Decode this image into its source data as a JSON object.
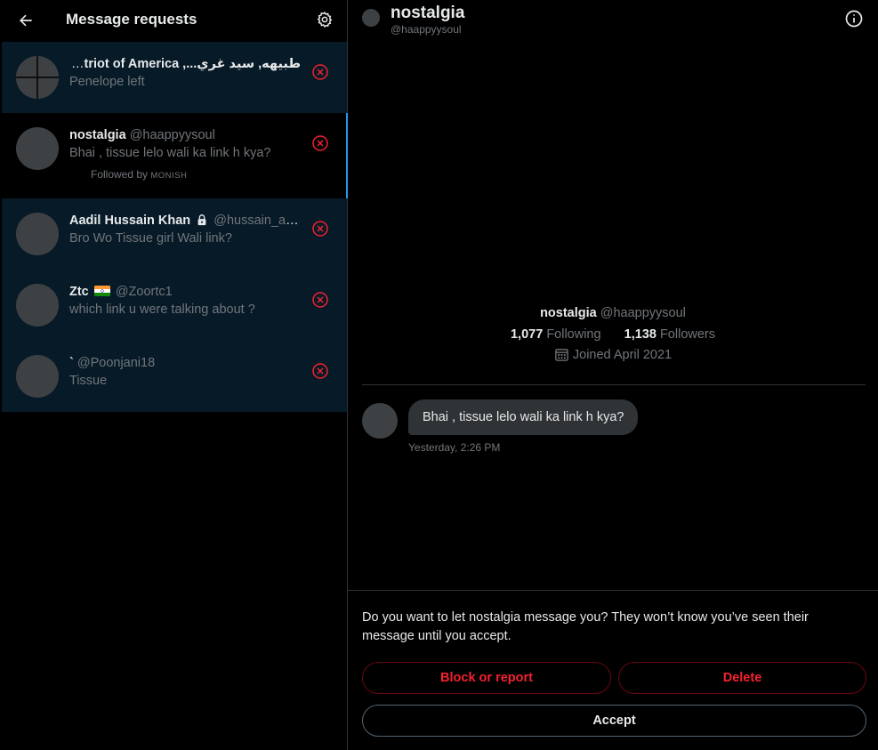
{
  "left": {
    "title": "Message requests",
    "requests": [
      {
        "name": "طبيهه, سيد غري..., Patriot of America",
        "handle": "",
        "preview": "Penelope left",
        "sub": ""
      },
      {
        "name": "nostalgia",
        "handle": "@haappyysoul",
        "preview": "Bhai , tissue lelo wali ka link h kya?",
        "sub_prefix": "Followed by",
        "sub_name": "MONISH"
      },
      {
        "name": "Aadil Hussain Khan",
        "handle": "@hussain_aa...",
        "preview": "Bro Wo Tissue girl Wali link?"
      },
      {
        "name": "Ztc",
        "handle": "@Zoortc1",
        "preview": "which link u were talking about ?"
      },
      {
        "name": "`",
        "handle": "@Poonjani18",
        "preview": "Tissue"
      }
    ]
  },
  "right": {
    "header": {
      "name": "nostalgia",
      "handle": "@haappyysoul"
    },
    "profile": {
      "name": "nostalgia",
      "handle": "@haappyysoul",
      "following_count": "1,077",
      "following_label": "Following",
      "followers_count": "1,138",
      "followers_label": "Followers",
      "joined": "Joined April 2021"
    },
    "message": {
      "text": "Bhai , tissue lelo wali ka link h kya?",
      "time": "Yesterday, 2:26 PM"
    },
    "prompt": "Do you want to let nostalgia message you? They won’t know you’ve seen their message until you accept.",
    "buttons": {
      "block": "Block or report",
      "delete": "Delete",
      "accept": "Accept"
    }
  },
  "colors": {
    "accent": "#1d9bf0",
    "danger": "#f4212e",
    "unread_bg": "#071a27",
    "muted_text": "#71767b"
  }
}
